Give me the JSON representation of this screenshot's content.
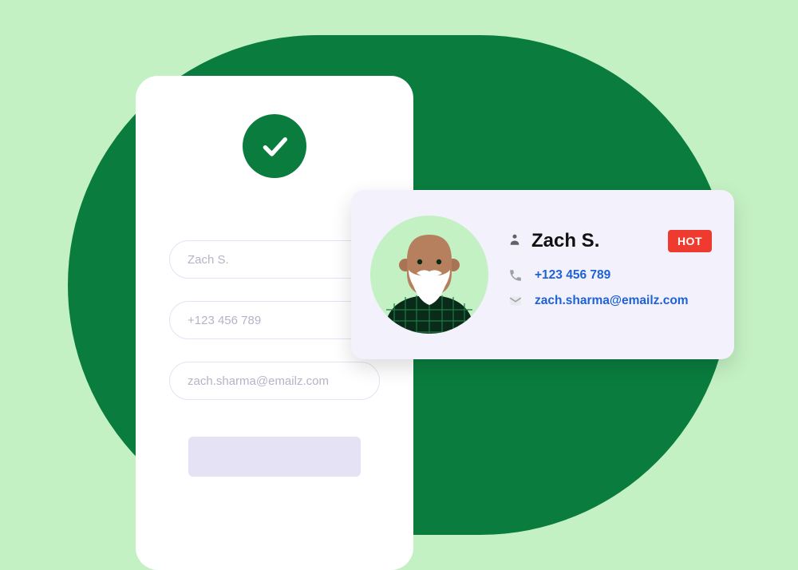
{
  "form": {
    "name_value": "Zach S.",
    "phone_value": "+123 456 789",
    "email_value": "zach.sharma@emailz.com"
  },
  "contact": {
    "name": "Zach S.",
    "badge": "HOT",
    "phone": "+123 456 789",
    "email": "zach.sharma@emailz.com"
  },
  "colors": {
    "bg_light": "#c4f1c4",
    "bg_pill": "#0a7d3e",
    "accent": "#0a7d3e",
    "badge": "#ef3b2f",
    "link": "#1d62d6"
  }
}
